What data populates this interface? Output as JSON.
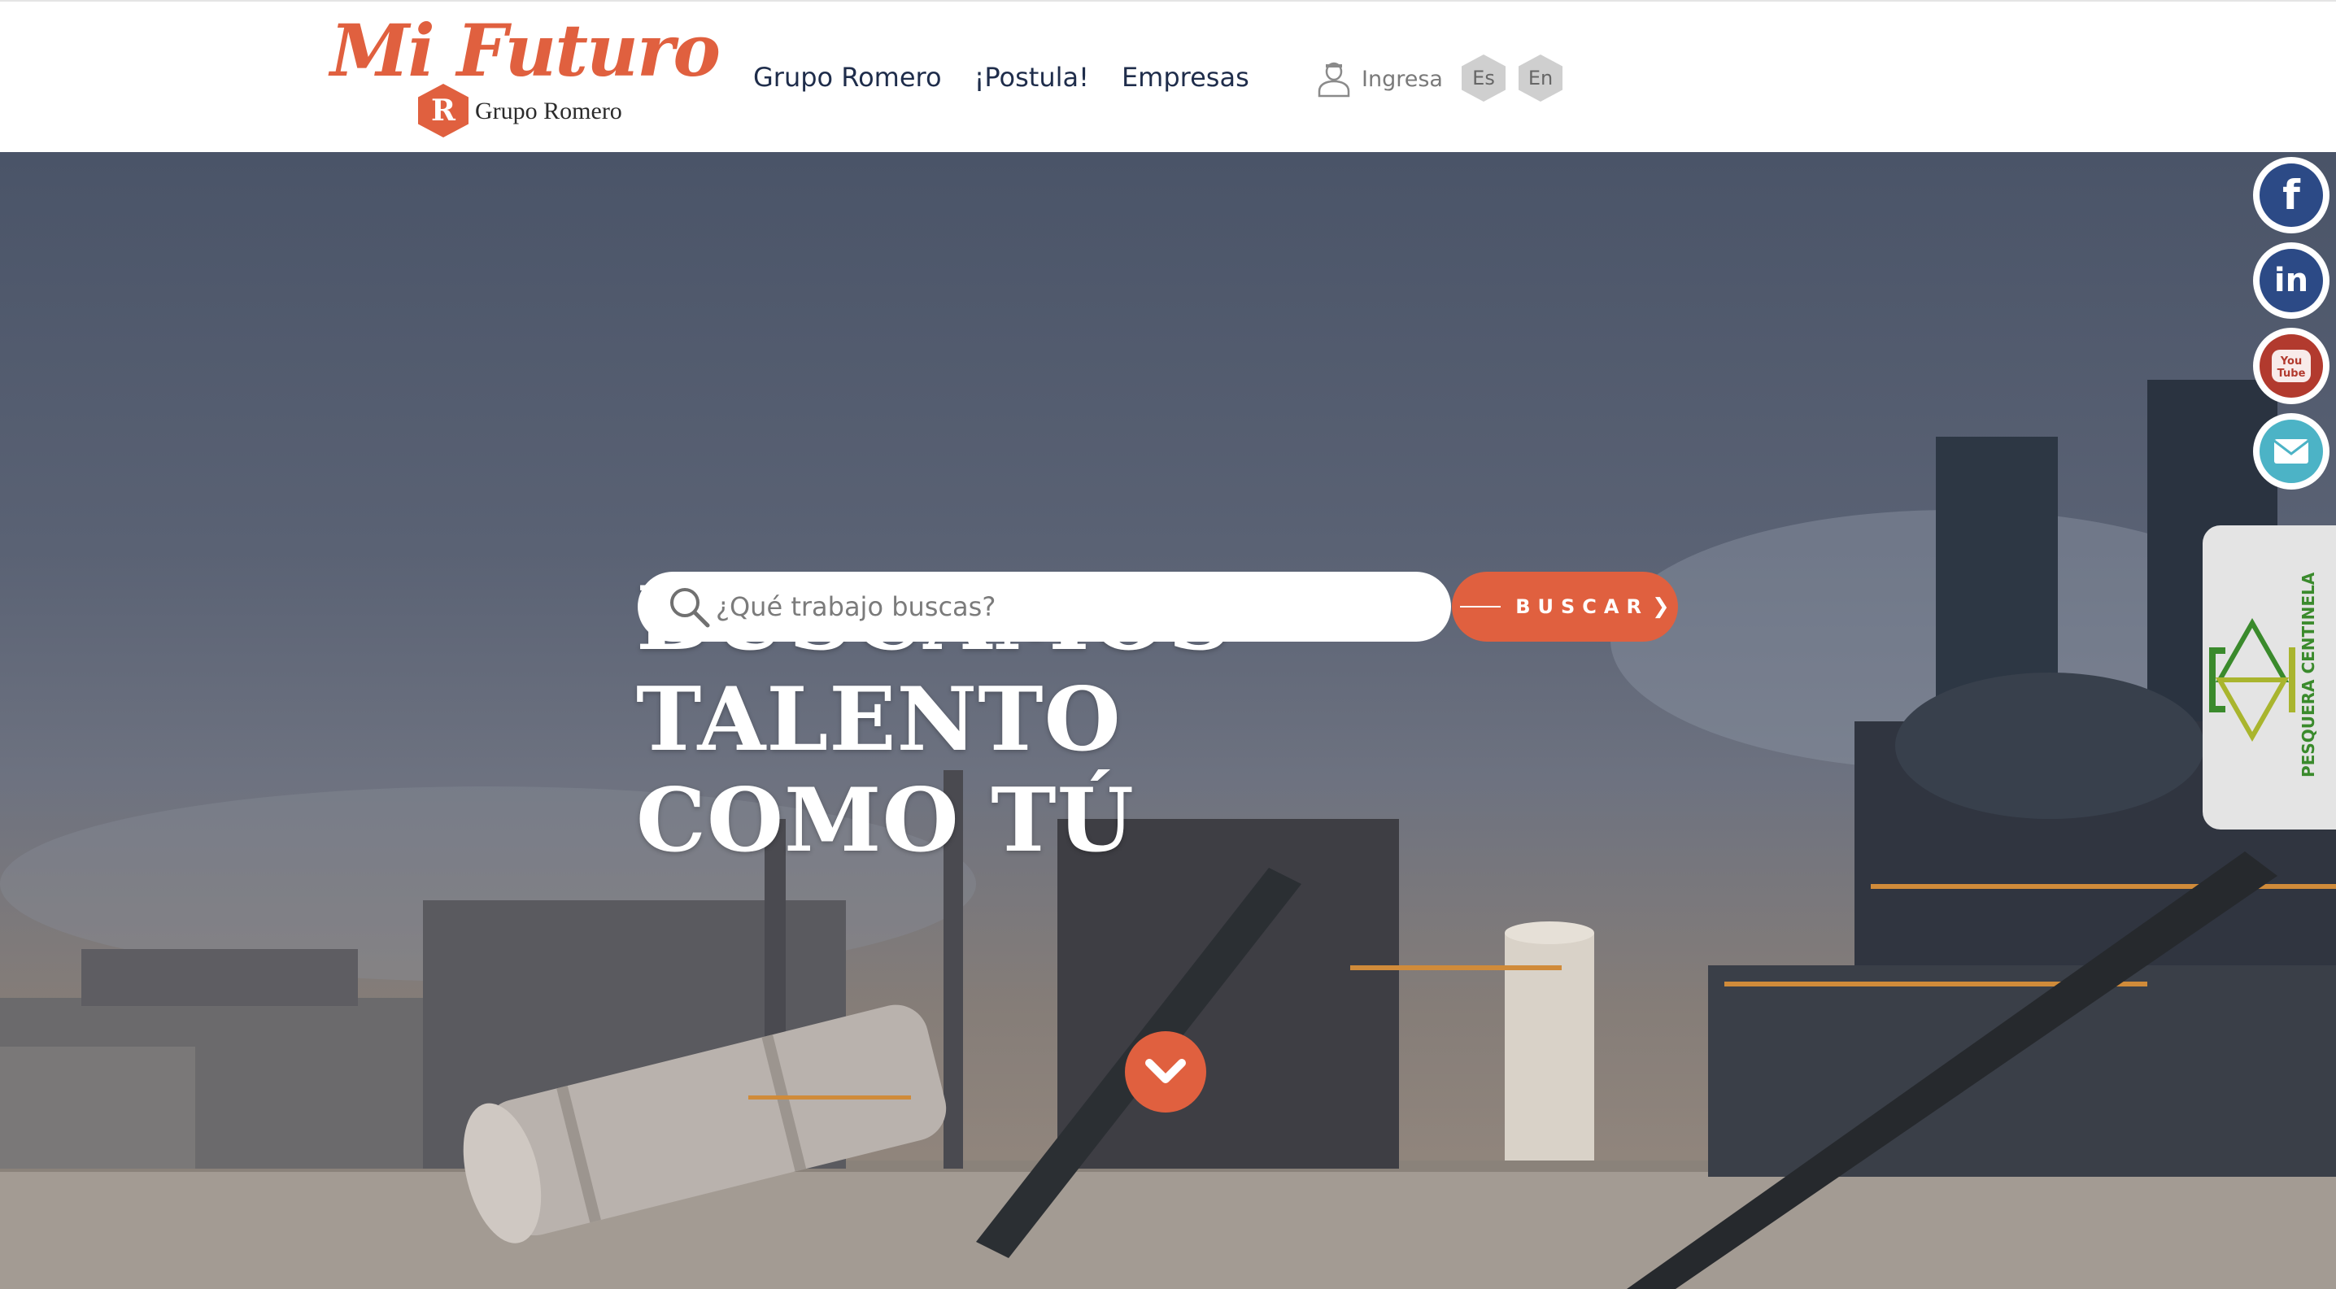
{
  "brand": {
    "script": "Mi Futuro",
    "badge_letter": "R",
    "company": "Grupo Romero"
  },
  "nav": {
    "items": [
      "Grupo Romero",
      "¡Postula!",
      "Empresas"
    ]
  },
  "login": {
    "label": "Ingresa"
  },
  "languages": [
    "Es",
    "En"
  ],
  "hero": {
    "title_line1": "BUSCAMOS TALENTO",
    "title_line2": "COMO TÚ",
    "search_placeholder": "¿Qué trabajo buscas?",
    "search_button": "BUSCAR"
  },
  "social": {
    "facebook_glyph": "f",
    "linkedin_glyph": "in",
    "youtube_glyph": "You Tube",
    "mail_icon": "mail-icon"
  },
  "partner": {
    "name": "PESQUERA CENTINELA"
  },
  "colors": {
    "accent": "#e0603f",
    "nav_text": "#1f2d4b",
    "facebook": "#2c4a86",
    "youtube": "#b23a2e",
    "mail": "#4cb3c6",
    "partner_green": "#3a8a2c"
  }
}
